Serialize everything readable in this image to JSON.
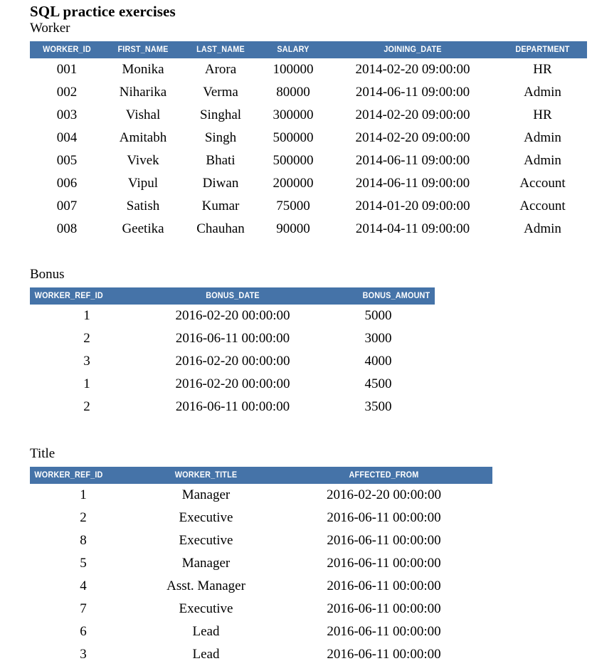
{
  "document": {
    "title": "SQL practice exercises",
    "accent_color": "#4573a8",
    "header_text_color": "#ffffff",
    "page_background": "#ffffff"
  },
  "tables": {
    "worker": {
      "label": "Worker",
      "columns": [
        "WORKER_ID",
        "FIRST_NAME",
        "LAST_NAME",
        "SALARY",
        "JOINING_DATE",
        "DEPARTMENT"
      ],
      "rows": [
        [
          "001",
          "Monika",
          "Arora",
          "100000",
          "2014-02-20 09:00:00",
          "HR"
        ],
        [
          "002",
          "Niharika",
          "Verma",
          "80000",
          "2014-06-11 09:00:00",
          "Admin"
        ],
        [
          "003",
          "Vishal",
          "Singhal",
          "300000",
          "2014-02-20 09:00:00",
          "HR"
        ],
        [
          "004",
          "Amitabh",
          "Singh",
          "500000",
          "2014-02-20 09:00:00",
          "Admin"
        ],
        [
          "005",
          "Vivek",
          "Bhati",
          "500000",
          "2014-06-11 09:00:00",
          "Admin"
        ],
        [
          "006",
          "Vipul",
          "Diwan",
          "200000",
          "2014-06-11 09:00:00",
          "Account"
        ],
        [
          "007",
          "Satish",
          "Kumar",
          "75000",
          "2014-01-20 09:00:00",
          "Account"
        ],
        [
          "008",
          "Geetika",
          "Chauhan",
          "90000",
          "2014-04-11 09:00:00",
          "Admin"
        ]
      ]
    },
    "bonus": {
      "label": "Bonus",
      "columns": [
        "WORKER_REF_ID",
        "BONUS_DATE",
        "BONUS_AMOUNT"
      ],
      "rows": [
        [
          "1",
          "2016-02-20 00:00:00",
          "5000"
        ],
        [
          "2",
          "2016-06-11 00:00:00",
          "3000"
        ],
        [
          "3",
          "2016-02-20 00:00:00",
          "4000"
        ],
        [
          "1",
          "2016-02-20 00:00:00",
          "4500"
        ],
        [
          "2",
          "2016-06-11 00:00:00",
          "3500"
        ]
      ]
    },
    "title": {
      "label": "Title",
      "columns": [
        "WORKER_REF_ID",
        "WORKER_TITLE",
        "AFFECTED_FROM"
      ],
      "rows": [
        [
          "1",
          "Manager",
          "2016-02-20 00:00:00"
        ],
        [
          "2",
          "Executive",
          "2016-06-11 00:00:00"
        ],
        [
          "8",
          "Executive",
          "2016-06-11 00:00:00"
        ],
        [
          "5",
          "Manager",
          "2016-06-11 00:00:00"
        ],
        [
          "4",
          "Asst. Manager",
          "2016-06-11 00:00:00"
        ],
        [
          "7",
          "Executive",
          "2016-06-11 00:00:00"
        ],
        [
          "6",
          "Lead",
          "2016-06-11 00:00:00"
        ],
        [
          "3",
          "Lead",
          "2016-06-11 00:00:00"
        ]
      ]
    }
  }
}
